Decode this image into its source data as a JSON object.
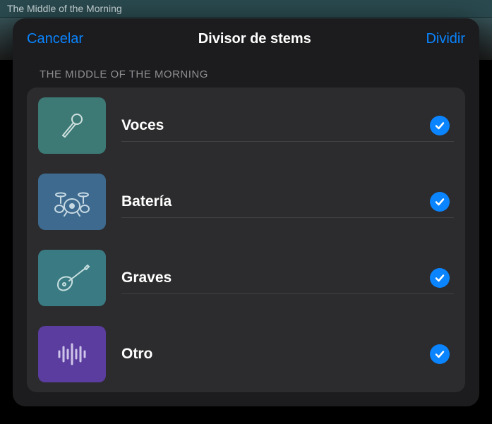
{
  "track_title": "The Middle of the Morning",
  "modal": {
    "cancel_label": "Cancelar",
    "title": "Divisor de stems",
    "split_label": "Dividir",
    "section_title": "THE MIDDLE OF THE MORNING",
    "stems": [
      {
        "label": "Voces",
        "icon": "mic",
        "tile_color": "#3d7a76",
        "checked": true
      },
      {
        "label": "Batería",
        "icon": "drums",
        "tile_color": "#3d6a8e",
        "checked": true
      },
      {
        "label": "Graves",
        "icon": "guitar",
        "tile_color": "#3a7a83",
        "checked": true
      },
      {
        "label": "Otro",
        "icon": "waveform",
        "tile_color": "#5a3d9e",
        "checked": true
      }
    ]
  }
}
